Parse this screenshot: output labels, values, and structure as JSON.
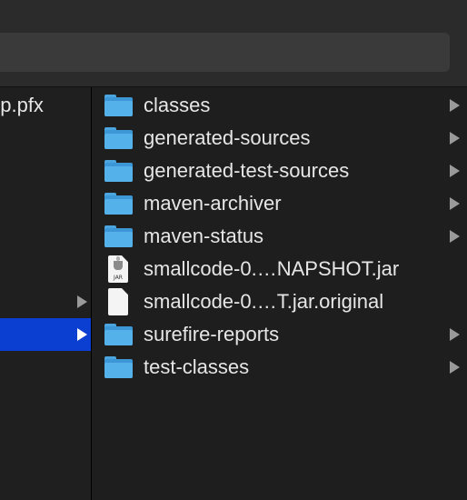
{
  "left_column": {
    "items": [
      {
        "label": "pp.pfx",
        "has_chevron": false,
        "selected": false
      },
      {
        "label": "",
        "has_chevron": true,
        "selected": false
      },
      {
        "label": "",
        "has_chevron": true,
        "selected": true
      }
    ]
  },
  "files": [
    {
      "name": "classes",
      "type": "folder",
      "icon": "folder-icon",
      "has_chevron": true
    },
    {
      "name": "generated-sources",
      "type": "folder",
      "icon": "folder-icon",
      "has_chevron": true
    },
    {
      "name": "generated-test-sources",
      "type": "folder",
      "icon": "folder-icon",
      "has_chevron": true
    },
    {
      "name": "maven-archiver",
      "type": "folder",
      "icon": "folder-icon",
      "has_chevron": true
    },
    {
      "name": "maven-status",
      "type": "folder",
      "icon": "folder-icon",
      "has_chevron": true
    },
    {
      "name": "smallcode-0.…NAPSHOT.jar",
      "type": "jar",
      "icon": "jar-file-icon",
      "icon_label": "JAR",
      "has_chevron": false
    },
    {
      "name": "smallcode-0.…T.jar.original",
      "type": "file",
      "icon": "document-icon",
      "has_chevron": false
    },
    {
      "name": "surefire-reports",
      "type": "folder",
      "icon": "folder-icon",
      "has_chevron": true
    },
    {
      "name": "test-classes",
      "type": "folder",
      "icon": "folder-icon",
      "has_chevron": true
    }
  ],
  "colors": {
    "selection": "#0a3fd1",
    "folder": "#55b1ea",
    "background": "#1e1e1e",
    "text": "#e6e6e6",
    "chevron": "#9a9a9a"
  }
}
